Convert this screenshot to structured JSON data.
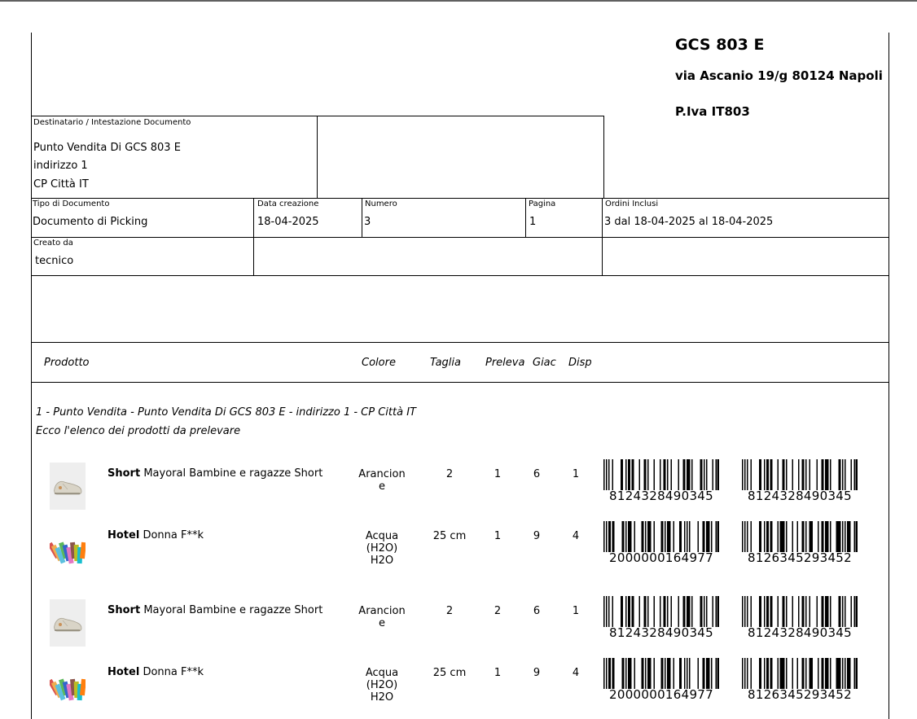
{
  "company": {
    "name": "GCS 803 E",
    "address": "via Ascanio 19/g 80124 Napoli",
    "vat": "P.Iva IT803"
  },
  "recipient": {
    "label": "Destinatario / Intestazione Documento",
    "line1": "Punto Vendita Di GCS 803 E",
    "line2": "indirizzo 1",
    "line3": "CP Città IT"
  },
  "doc": {
    "type_label": "Tipo di Documento",
    "type_value": "Documento di Picking",
    "date_label": "Data creazione",
    "date_value": "18-04-2025",
    "number_label": "Numero",
    "number_value": "3",
    "page_label": "Pagina",
    "page_value": "1",
    "orders_label": "Ordini Inclusi",
    "orders_value": "3 dal 18-04-2025 al 18-04-2025",
    "created_by_label": "Creato da",
    "created_by_value": "tecnico"
  },
  "table": {
    "headers": {
      "product": "Prodotto",
      "color": "Colore",
      "size": "Taglia",
      "pick": "Preleva",
      "stock": "Giac",
      "avail": "Disp"
    },
    "section_title": "1 -  Punto Vendita - Punto Vendita Di GCS 803 E - indirizzo 1 - CP Città IT",
    "section_subtitle": "Ecco l'elenco dei prodotti da prelevare",
    "rows": [
      {
        "image": "shoe-image",
        "name_bold": "Short",
        "name_rest": " Mayoral Bambine e ragazze Short",
        "color": "Arancion\ne",
        "size": "2",
        "pick": "1",
        "stock": "6",
        "avail": "1",
        "barcode1": "8124328490345",
        "barcode2": "8124328490345"
      },
      {
        "image": "paint-swatches-image",
        "name_bold": "Hotel",
        "name_rest": " Donna F**k",
        "color": "Acqua\n(H2O)\nH2O",
        "size": "25 cm",
        "pick": "1",
        "stock": "9",
        "avail": "4",
        "barcode1": "2000000164977",
        "barcode2": "8126345293452"
      },
      {
        "image": "shoe-image",
        "name_bold": "Short",
        "name_rest": " Mayoral Bambine e ragazze Short",
        "color": "Arancion\ne",
        "size": "2",
        "pick": "2",
        "stock": "6",
        "avail": "1",
        "barcode1": "8124328490345",
        "barcode2": "8124328490345"
      },
      {
        "image": "paint-swatches-image",
        "name_bold": "Hotel",
        "name_rest": " Donna F**k",
        "color": "Acqua\n(H2O)\nH2O",
        "size": "25 cm",
        "pick": "1",
        "stock": "9",
        "avail": "4",
        "barcode1": "2000000164977",
        "barcode2": "8126345293452"
      }
    ]
  }
}
